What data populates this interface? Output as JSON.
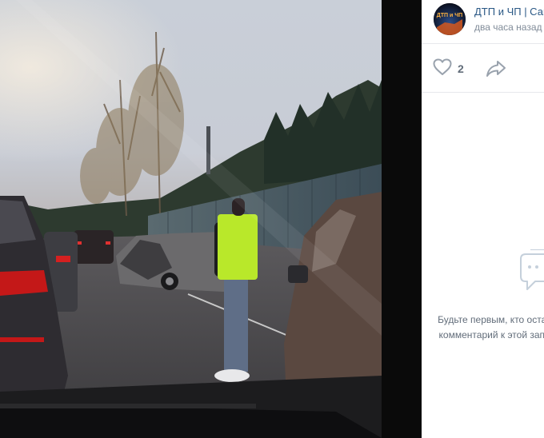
{
  "post": {
    "author": "ДТП и ЧП | Санкт-Петербург",
    "time": "два часа назад",
    "likes": "2"
  },
  "avatar": {
    "text_line1": "ДТП и ЧП",
    "text_line2": "Санкт-Петербург"
  },
  "comments": {
    "empty_line1": "Будьте первым, кто оставит",
    "empty_line2": "комментарий к этой записи"
  },
  "icons": {
    "like": "heart-icon",
    "share": "share-icon",
    "empty": "comments-icon"
  },
  "colors": {
    "link": "#2a5885",
    "secondary": "#818c99",
    "icon": "#99a2ad"
  }
}
